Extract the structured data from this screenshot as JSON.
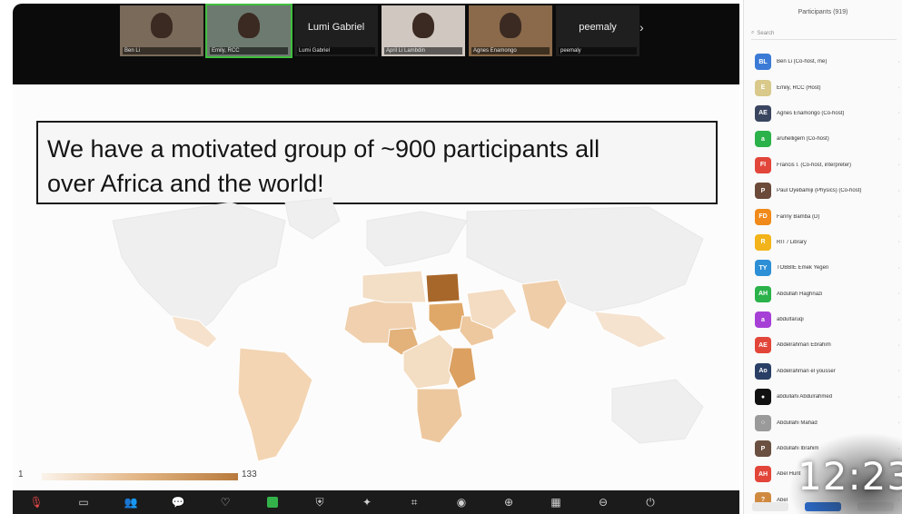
{
  "meeting": {
    "tiles": [
      {
        "name": "Ben Li",
        "kind": "video"
      },
      {
        "name": "Emily, RCC",
        "kind": "video",
        "active": true
      },
      {
        "name": "Lumi Gabriel",
        "kind": "text",
        "display": "Lumi Gabriel"
      },
      {
        "name": "April Li Lambdin",
        "kind": "video"
      },
      {
        "name": "Agnes Enamongo",
        "kind": "video"
      },
      {
        "name": "peemaly",
        "kind": "text",
        "display": "peemaly"
      }
    ],
    "next_icon": "chevron-right-icon"
  },
  "slide": {
    "callout_line1": "We have a motivated group of ~900 participants all",
    "callout_line2": "over Africa and the world!",
    "legend_min": "1",
    "legend_max": "133",
    "colors": {
      "low": "#fbf3ea",
      "mid": "#e2b584",
      "high": "#b87a3c",
      "egypt": "#a8672a"
    }
  },
  "toolbar": {
    "buttons": [
      {
        "icon": "mic-muted-icon"
      },
      {
        "icon": "video-camera-icon"
      },
      {
        "icon": "participants-icon"
      },
      {
        "icon": "chat-icon"
      },
      {
        "icon": "reactions-icon"
      },
      {
        "icon": "share-screen-icon"
      },
      {
        "icon": "security-icon"
      },
      {
        "icon": "apps-icon"
      },
      {
        "icon": "whiteboard-icon"
      },
      {
        "icon": "record-icon"
      },
      {
        "icon": "globe-icon"
      },
      {
        "icon": "breakout-icon"
      },
      {
        "icon": "more-icon"
      },
      {
        "icon": "leave-icon"
      }
    ]
  },
  "panel": {
    "title": "Participants (919)",
    "search_placeholder": "Search",
    "participants": [
      {
        "initials": "BL",
        "color": "#3b7bd6",
        "name": "Ben Li (Co-host, me)"
      },
      {
        "initials": "E",
        "color": "#d9c98a",
        "name": "Emily, RCC (Host)"
      },
      {
        "initials": "AE",
        "color": "#3a4660",
        "name": "Agnes Enamongo (Co-host)"
      },
      {
        "initials": "a",
        "color": "#2bb24a",
        "name": "aruhelligem (Co-host)"
      },
      {
        "initials": "FI",
        "color": "#e2463a",
        "name": "Francis I. (Co-host, interpreter)"
      },
      {
        "initials": "P",
        "color": "#6b4a3a",
        "name": "Paul Oyebamiji (Physics) (Co-host)"
      },
      {
        "initials": "FD",
        "color": "#f08a1a",
        "name": "Fanny Bamba (D)"
      },
      {
        "initials": "R",
        "color": "#f2b41a",
        "name": "RIT / Library"
      },
      {
        "initials": "TY",
        "color": "#2d8fd6",
        "name": "TOBBIE Emek Yegen"
      },
      {
        "initials": "AH",
        "color": "#2bb24a",
        "name": "Abdullah Haghnazi"
      },
      {
        "initials": "a",
        "color": "#a63fd6",
        "name": "abdulfaruqi"
      },
      {
        "initials": "AE",
        "color": "#e2463a",
        "name": "Abdelrahman Ebrahim"
      },
      {
        "initials": "Ao",
        "color": "#2a3f66",
        "name": "Abdelrahman el yousser"
      },
      {
        "initials": "●",
        "color": "#111111",
        "name": "abdullahi Abdulrahmed"
      },
      {
        "initials": "○",
        "color": "#9a9a9a",
        "name": "Abdullahi Mahad"
      },
      {
        "initials": "P",
        "color": "#6a5040",
        "name": "Abdullahi Ibrahim"
      },
      {
        "initials": "AH",
        "color": "#e2463a",
        "name": "Abel Hunt"
      },
      {
        "initials": "?",
        "color": "#d08a40",
        "name": "Abel"
      }
    ]
  },
  "timestamp": "12:23"
}
